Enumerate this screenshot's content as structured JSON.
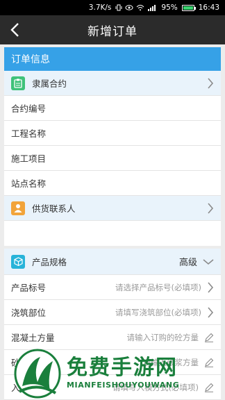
{
  "status_bar": {
    "speed": "3.7K/s",
    "battery_pct": "95%",
    "time": "16:43",
    "battery_color": "#3bd16f"
  },
  "titlebar": {
    "title": "新增订单"
  },
  "order_info": {
    "header": "订单信息",
    "contract": {
      "label": "隶属合约",
      "icon": "clipboard-icon",
      "icon_color": "#3fc27a"
    },
    "fields": [
      {
        "label": "合约编号"
      },
      {
        "label": "工程名称"
      },
      {
        "label": "施工项目"
      },
      {
        "label": "站点名称"
      }
    ],
    "contact": {
      "label": "供货联系人",
      "icon": "person-icon",
      "icon_color": "#f2a43a"
    }
  },
  "product_spec": {
    "header": "产品规格",
    "mode": "高级",
    "icon": "box-icon",
    "icon_color": "#27b3d9",
    "rows": [
      {
        "label": "产品标号",
        "placeholder": "请选择产品标号(必填项)",
        "action": "chevron-right-icon"
      },
      {
        "label": "浇筑部位",
        "placeholder": "请填写浇筑部位(必填项)",
        "action": "chevron-right-icon"
      },
      {
        "label": "混凝土方量",
        "placeholder": "请输入订购的砼方量",
        "action": "pencil-icon"
      },
      {
        "label": "砂浆",
        "placeholder": "请输入砂浆方量",
        "action": "pencil-icon"
      },
      {
        "label": "入模方式",
        "placeholder": "请填写入模方式(必填项)",
        "action": "pencil-icon"
      }
    ]
  },
  "watermark": {
    "title": "免费手游网",
    "subtitle": "MIANFEISHOUYOUWANG",
    "color": "#1a7f3c"
  },
  "colors": {
    "accent": "#36a1e7",
    "titlebar": "#2b2b2b",
    "row_highlight": "#e9f3fb"
  }
}
